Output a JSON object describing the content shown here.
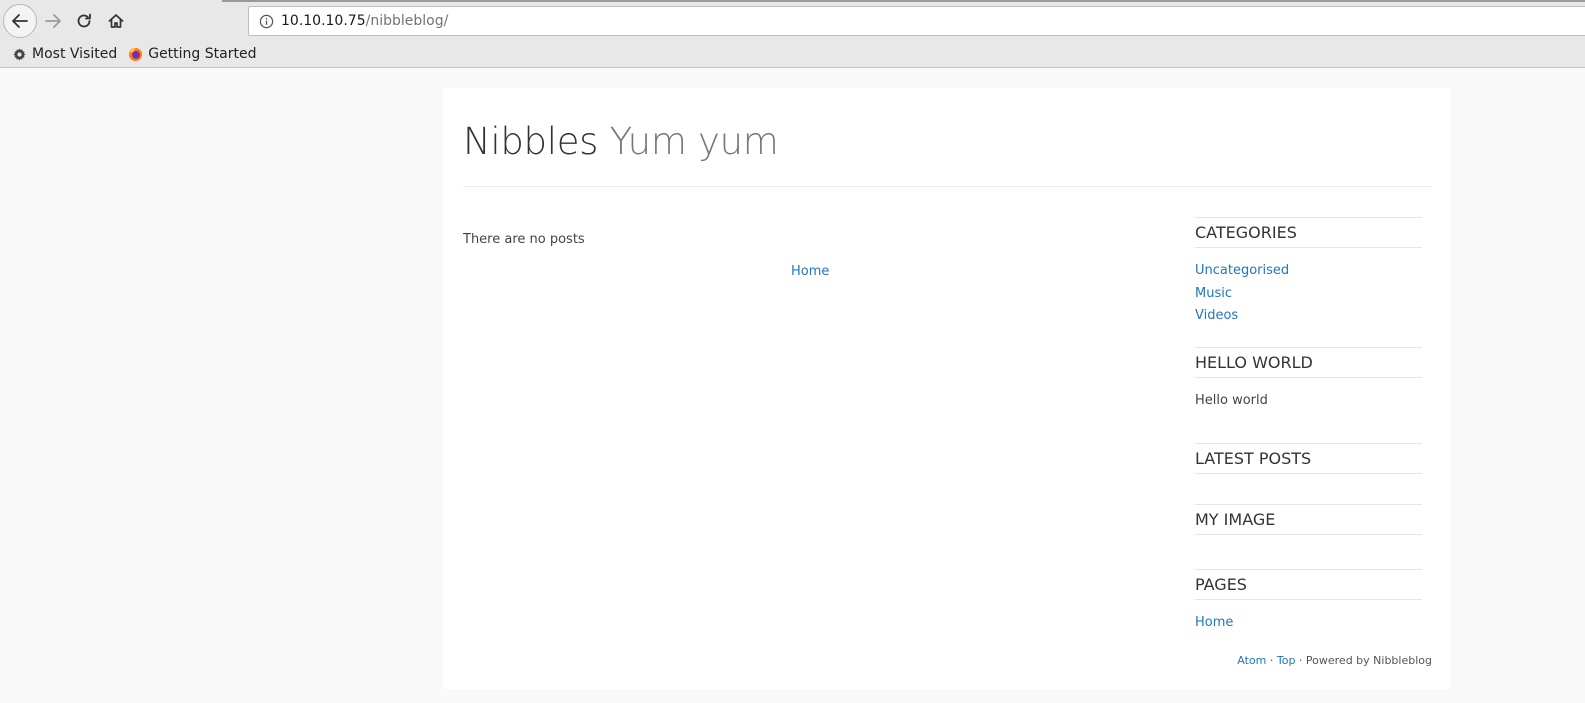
{
  "browser": {
    "url_host": "10.10.10.75",
    "url_path": "/nibbleblog/",
    "bookmarks": [
      {
        "label": "Most Visited",
        "icon": "gear-icon"
      },
      {
        "label": "Getting Started",
        "icon": "firefox-icon"
      }
    ]
  },
  "site": {
    "title": "Nibbles",
    "slogan": "Yum yum"
  },
  "main": {
    "no_posts": "There are no posts",
    "pager_home": "Home"
  },
  "sidebar": {
    "categories": {
      "title": "CATEGORIES",
      "items": [
        "Uncategorised",
        "Music",
        "Videos"
      ]
    },
    "hello_world": {
      "title": "HELLO WORLD",
      "text": "Hello world"
    },
    "latest_posts": {
      "title": "LATEST POSTS"
    },
    "my_image": {
      "title": "MY IMAGE"
    },
    "pages": {
      "title": "PAGES",
      "items": [
        "Home"
      ]
    }
  },
  "footer": {
    "atom": "Atom",
    "sep1": " · ",
    "top": "Top",
    "powered": " · Powered by Nibbleblog"
  },
  "colors": {
    "link": "#2277bb",
    "text": "#333333"
  }
}
